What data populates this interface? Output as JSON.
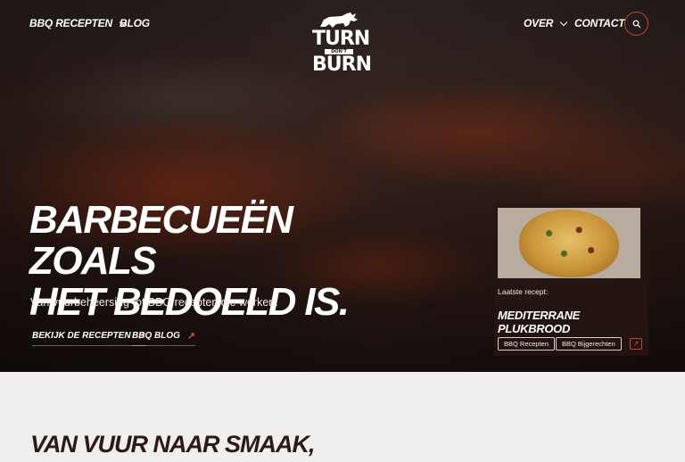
{
  "nav": {
    "recipes_label": "BBQ RECEPTEN",
    "blog_label": "BLOG",
    "about_label": "OVER",
    "contact_label": "CONTACT",
    "search_icon": "search-icon"
  },
  "logo": {
    "line1": "TURN",
    "line2": "DON'T",
    "line3": "BURN"
  },
  "hero": {
    "headline_line1": "BARBECUEËN ZOALS",
    "headline_line2": "HET BEDOELD IS.",
    "subtitle": "Van vuurbeheersing tot BBQ recepten die werken.",
    "cta_recipes": "BEKIJK DE RECEPTEN",
    "cta_blog": "BBQ BLOG"
  },
  "latest": {
    "label": "Laatste recept:",
    "title": "MEDITERRANE PLUKBROOD",
    "tags": [
      "BBQ Recepten",
      "BBQ Bijgerechten"
    ]
  },
  "section": {
    "title": "VAN VUUR NAAR SMAAK,"
  },
  "colors": {
    "accent": "#c4462a",
    "dark": "#2b1a17",
    "light_bg": "#f1eeee"
  }
}
